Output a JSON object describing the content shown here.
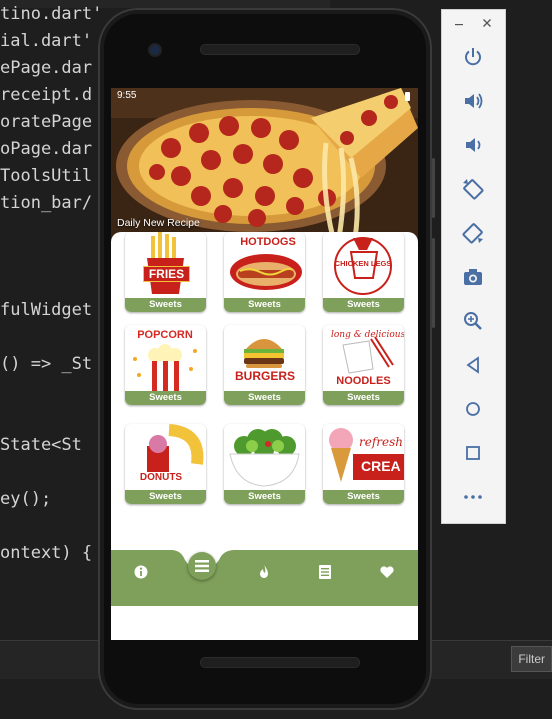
{
  "ide": {
    "code_lines": [
      "tino.dart'",
      "ial.dart'",
      "ePage.dar",
      "receipt.d",
      "oratePage",
      "oPage.dar",
      "ToolsUtil",
      "tion_bar/",
      "fulWidget",
      "() => _St",
      "State<St",
      "ey();",
      "ontext) {"
    ],
    "filter_label": "Filter"
  },
  "app": {
    "status_time": "9:55",
    "hero_title": "Daily New Recipe",
    "cards": [
      {
        "label": "Sweets",
        "art_text": "FRIES"
      },
      {
        "label": "Sweets",
        "art_text": "HOTDOGS"
      },
      {
        "label": "Sweets",
        "art_text": "CHICKEN LEGS"
      },
      {
        "label": "Sweets",
        "art_text": "POPCORN"
      },
      {
        "label": "Sweets",
        "art_text": "BURGERS"
      },
      {
        "label": "Sweets",
        "art_text": "NOODLES"
      },
      {
        "label": "Sweets",
        "art_text": "DONUTS"
      },
      {
        "label": "Sweets",
        "art_text": ""
      },
      {
        "label": "Sweets",
        "art_text": "CREA"
      }
    ],
    "nav_items": [
      "info-icon",
      "menu-icon",
      "fire-icon",
      "list-icon",
      "heart-icon"
    ],
    "accent_color": "#7ea05a"
  },
  "emulator_panel": {
    "buttons": [
      "power-icon",
      "volume-up-icon",
      "volume-down-icon",
      "rotate-left-icon",
      "rotate-right-icon",
      "camera-icon",
      "zoom-icon",
      "back-icon",
      "home-icon",
      "overview-icon",
      "more-icon"
    ]
  }
}
